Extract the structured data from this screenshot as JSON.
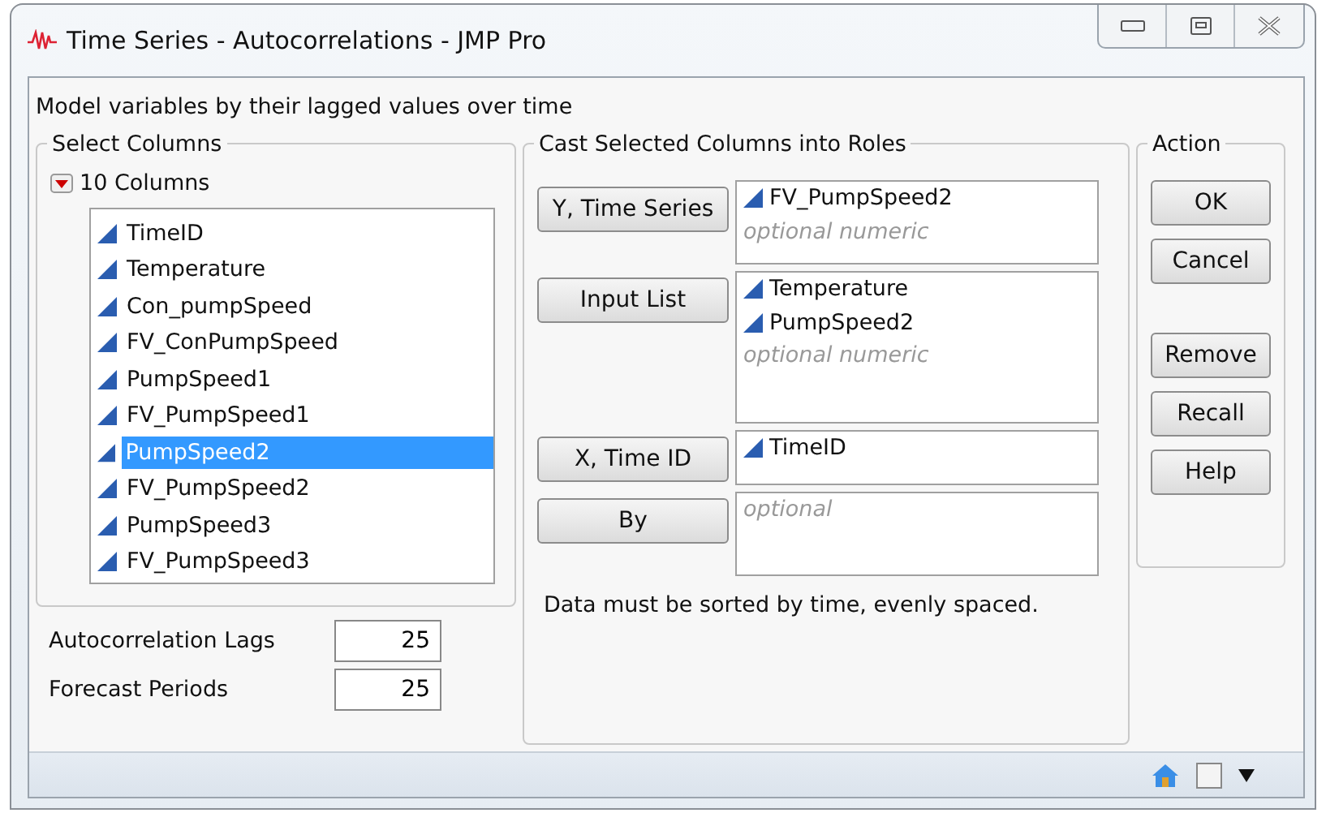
{
  "window": {
    "title": "Time Series - Autocorrelations - JMP Pro"
  },
  "description": "Model variables by their lagged values over time",
  "select_columns": {
    "legend": "Select Columns",
    "count_label": "10 Columns",
    "columns": [
      {
        "name": "TimeID",
        "selected": false
      },
      {
        "name": "Temperature",
        "selected": false
      },
      {
        "name": "Con_pumpSpeed",
        "selected": false
      },
      {
        "name": "FV_ConPumpSpeed",
        "selected": false
      },
      {
        "name": "PumpSpeed1",
        "selected": false
      },
      {
        "name": "FV_PumpSpeed1",
        "selected": false
      },
      {
        "name": "PumpSpeed2",
        "selected": true
      },
      {
        "name": "FV_PumpSpeed2",
        "selected": false
      },
      {
        "name": "PumpSpeed3",
        "selected": false
      },
      {
        "name": "FV_PumpSpeed3",
        "selected": false
      }
    ]
  },
  "settings": [
    {
      "label": "Autocorrelation Lags",
      "value": "25"
    },
    {
      "label": "Forecast Periods",
      "value": "25"
    }
  ],
  "cast": {
    "legend": "Cast Selected Columns into Roles",
    "roles": [
      {
        "button": "Y, Time Series",
        "items": [
          "FV_PumpSpeed2"
        ],
        "hint": "optional numeric"
      },
      {
        "button": "Input List",
        "items": [
          "Temperature",
          "PumpSpeed2"
        ],
        "hint": "optional numeric"
      },
      {
        "button": "X, Time ID",
        "items": [
          "TimeID"
        ]
      },
      {
        "button": "By",
        "hint": "optional"
      }
    ],
    "note": "Data must be sorted by time, evenly spaced."
  },
  "action": {
    "legend": "Action",
    "buttons": [
      "OK",
      "Cancel",
      "Remove",
      "Recall",
      "Help"
    ]
  }
}
